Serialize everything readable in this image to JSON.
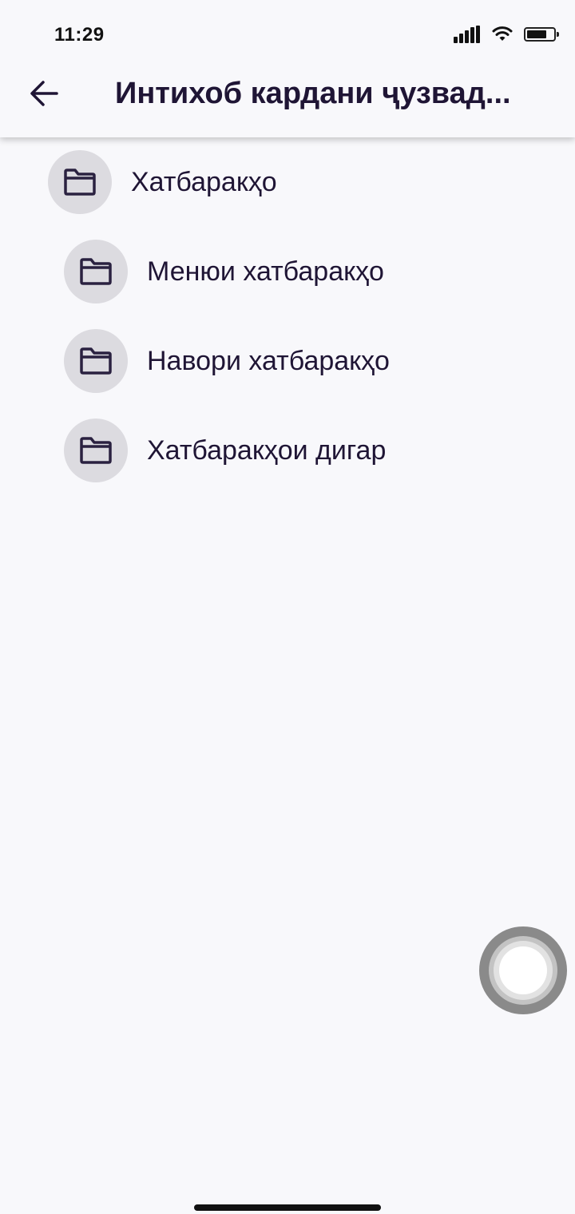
{
  "status_bar": {
    "time": "11:29",
    "icons": [
      "cellular-signal-icon",
      "wifi-icon",
      "battery-icon"
    ]
  },
  "header": {
    "back_icon": "arrow-left-icon",
    "title": "Интихоб кардани ҷузвад..."
  },
  "folders": [
    {
      "label": "Хатбаракҳо",
      "icon": "folder-icon"
    },
    {
      "label": "Менюи хатбаракҳо",
      "icon": "folder-icon"
    },
    {
      "label": "Навори хатбаракҳо",
      "icon": "folder-icon"
    },
    {
      "label": "Хатбаракҳои дигар",
      "icon": "folder-icon"
    }
  ],
  "colors": {
    "background": "#f8f8fb",
    "text": "#1f1535",
    "icon_circle": "#dcdbe0"
  }
}
